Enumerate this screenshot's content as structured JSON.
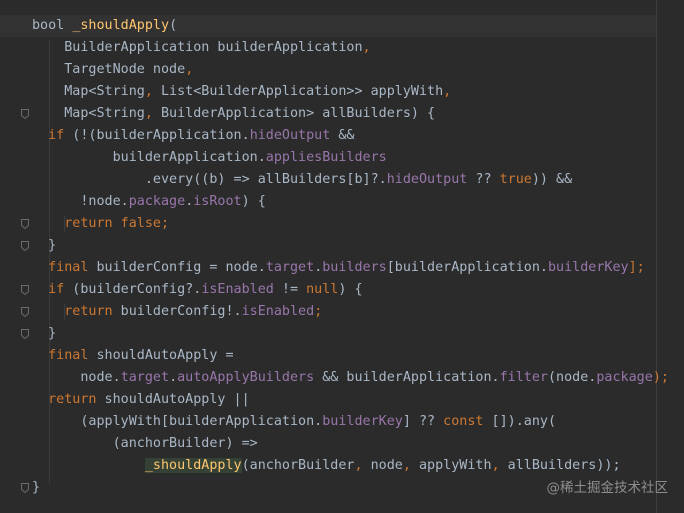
{
  "editor": {
    "lines": [
      [
        {
          "t": "bool ",
          "c": "op"
        },
        {
          "t": "_shouldApply",
          "c": "fn"
        },
        {
          "t": "(",
          "c": "op"
        }
      ],
      [
        {
          "t": "    BuilderApplication builderApplication",
          "c": "op"
        },
        {
          "t": ",",
          "c": "kw"
        }
      ],
      [
        {
          "t": "    TargetNode node",
          "c": "op"
        },
        {
          "t": ",",
          "c": "kw"
        }
      ],
      [
        {
          "t": "    Map<String",
          "c": "op"
        },
        {
          "t": ",",
          "c": "kw"
        },
        {
          "t": " List<BuilderApplication>> applyWith",
          "c": "op"
        },
        {
          "t": ",",
          "c": "kw"
        }
      ],
      [
        {
          "t": "    Map<String",
          "c": "op"
        },
        {
          "t": ",",
          "c": "kw"
        },
        {
          "t": " BuilderApplication> allBuilders) {",
          "c": "op"
        }
      ],
      [
        {
          "t": "  ",
          "c": "op"
        },
        {
          "t": "if",
          "c": "kw"
        },
        {
          "t": " (!(builderApplication.",
          "c": "op"
        },
        {
          "t": "hideOutput",
          "c": "fld"
        },
        {
          "t": " &&",
          "c": "op"
        }
      ],
      [
        {
          "t": "          builderApplication.",
          "c": "op"
        },
        {
          "t": "appliesBuilders",
          "c": "fld"
        }
      ],
      [
        {
          "t": "              .every((b) => allBuilders[b]?.",
          "c": "op"
        },
        {
          "t": "hideOutput",
          "c": "fld"
        },
        {
          "t": " ?? ",
          "c": "op"
        },
        {
          "t": "true",
          "c": "kw"
        },
        {
          "t": ")) &&",
          "c": "op"
        }
      ],
      [
        {
          "t": "      !node.",
          "c": "op"
        },
        {
          "t": "package",
          "c": "fld"
        },
        {
          "t": ".",
          "c": "op"
        },
        {
          "t": "isRoot",
          "c": "fld"
        },
        {
          "t": ") {",
          "c": "op"
        }
      ],
      [
        {
          "t": "    ",
          "c": "op"
        },
        {
          "t": "return false;",
          "c": "kw"
        }
      ],
      [
        {
          "t": "  }",
          "c": "op"
        }
      ],
      [
        {
          "t": "  ",
          "c": "op"
        },
        {
          "t": "final",
          "c": "kw"
        },
        {
          "t": " builderConfig = node.",
          "c": "op"
        },
        {
          "t": "target",
          "c": "fld"
        },
        {
          "t": ".",
          "c": "op"
        },
        {
          "t": "builders",
          "c": "fld"
        },
        {
          "t": "[builderApplication.",
          "c": "op"
        },
        {
          "t": "builderKey",
          "c": "fld"
        },
        {
          "t": "];",
          "c": "kw"
        }
      ],
      [
        {
          "t": "  ",
          "c": "op"
        },
        {
          "t": "if",
          "c": "kw"
        },
        {
          "t": " (builderConfig?.",
          "c": "op"
        },
        {
          "t": "isEnabled",
          "c": "fld"
        },
        {
          "t": " != ",
          "c": "op"
        },
        {
          "t": "null",
          "c": "kw"
        },
        {
          "t": ") {",
          "c": "op"
        }
      ],
      [
        {
          "t": "    ",
          "c": "op"
        },
        {
          "t": "return",
          "c": "kw"
        },
        {
          "t": " builderConfig!.",
          "c": "op"
        },
        {
          "t": "isEnabled",
          "c": "fld"
        },
        {
          "t": ";",
          "c": "kw"
        }
      ],
      [
        {
          "t": "  }",
          "c": "op"
        }
      ],
      [
        {
          "t": "  ",
          "c": "op"
        },
        {
          "t": "final",
          "c": "kw"
        },
        {
          "t": " shouldAutoApply =",
          "c": "op"
        }
      ],
      [
        {
          "t": "      node.",
          "c": "op"
        },
        {
          "t": "target",
          "c": "fld"
        },
        {
          "t": ".",
          "c": "op"
        },
        {
          "t": "autoApplyBuilders",
          "c": "fld"
        },
        {
          "t": " && builderApplication.",
          "c": "op"
        },
        {
          "t": "filter",
          "c": "fld"
        },
        {
          "t": "(node.",
          "c": "op"
        },
        {
          "t": "package",
          "c": "fld"
        },
        {
          "t": ");",
          "c": "kw"
        }
      ],
      [
        {
          "t": "  ",
          "c": "op"
        },
        {
          "t": "return",
          "c": "kw"
        },
        {
          "t": " shouldAutoApply ||",
          "c": "op"
        }
      ],
      [
        {
          "t": "      (applyWith[builderApplication.",
          "c": "op"
        },
        {
          "t": "builderKey",
          "c": "fld"
        },
        {
          "t": "] ?? ",
          "c": "op"
        },
        {
          "t": "const",
          "c": "kw"
        },
        {
          "t": " []).any(",
          "c": "op"
        }
      ],
      [
        {
          "t": "          (anchorBuilder) =>",
          "c": "op"
        }
      ],
      [
        {
          "t": "              ",
          "c": "op"
        },
        {
          "t": "_shouldApply",
          "c": "fn",
          "hl": true
        },
        {
          "t": "(anchorBuilder",
          "c": "op"
        },
        {
          "t": ",",
          "c": "kw"
        },
        {
          "t": " node",
          "c": "op"
        },
        {
          "t": ",",
          "c": "kw"
        },
        {
          "t": " applyWith",
          "c": "op"
        },
        {
          "t": ",",
          "c": "kw"
        },
        {
          "t": " allBuilders));",
          "c": "op"
        }
      ],
      [
        {
          "t": "}",
          "c": "op"
        }
      ]
    ],
    "fold_markers": [
      4,
      9,
      10,
      12,
      13,
      14,
      21
    ],
    "current_line": 0,
    "colors": {
      "background": "#2b2b2b",
      "keyword": "#cc7832",
      "function": "#ffc66d",
      "field": "#9876aa",
      "text": "#a9b7c6"
    }
  },
  "watermark": {
    "text": "@稀土掘金技术社区"
  }
}
